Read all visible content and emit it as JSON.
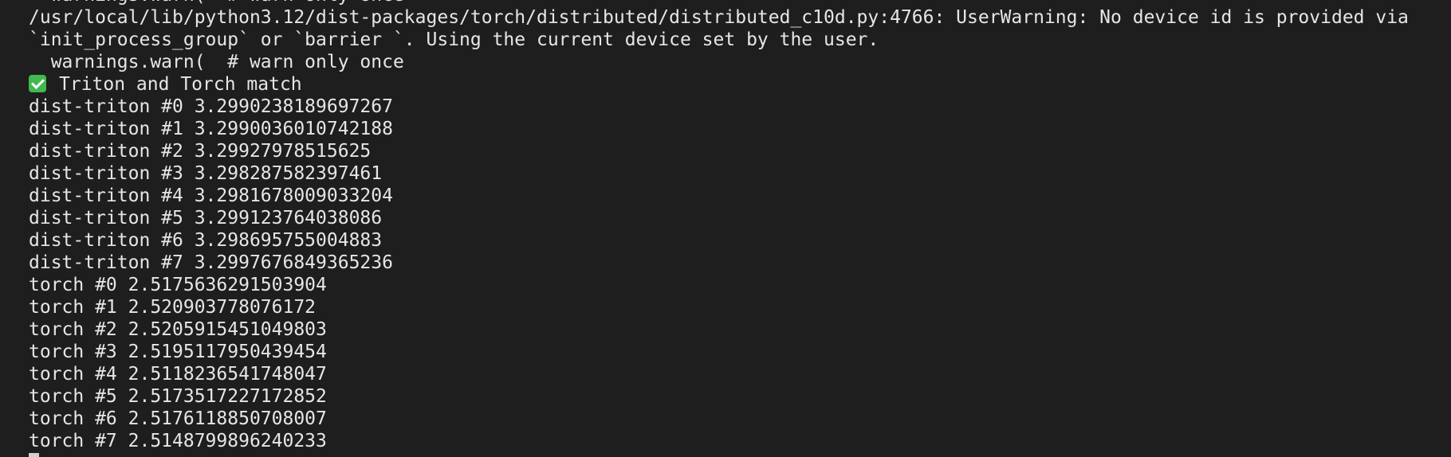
{
  "terminal": {
    "lines": [
      "  warnings.warn(  # warn only once",
      "/usr/local/lib/python3.12/dist-packages/torch/distributed/distributed_c10d.py:4766: UserWarning: No device id is provided via",
      "`init_process_group` or `barrier `. Using the current device set by the user.",
      "  warnings.warn(  # warn only once",
      "Triton and Torch match",
      "dist-triton #0 3.2990238189697267",
      "dist-triton #1 3.2990036010742188",
      "dist-triton #2 3.29927978515625",
      "dist-triton #3 3.298287582397461",
      "dist-triton #4 3.2981678009033204",
      "dist-triton #5 3.299123764038086",
      "dist-triton #6 3.298695755004883",
      "dist-triton #7 3.2997676849365236",
      "torch #0 2.5175636291503904",
      "torch #1 2.520903778076172",
      "torch #2 2.5205915451049803",
      "torch #3 2.5195117950439454",
      "torch #4 2.5118236541748047",
      "torch #5 2.5173517227172852",
      "torch #6 2.5176118850708007",
      "torch #7 2.5148799896240233"
    ],
    "check_icon": "check-mark-icon",
    "check_color": "#3fb950",
    "background": "#1e1e1e",
    "foreground": "#e6e6e6"
  }
}
